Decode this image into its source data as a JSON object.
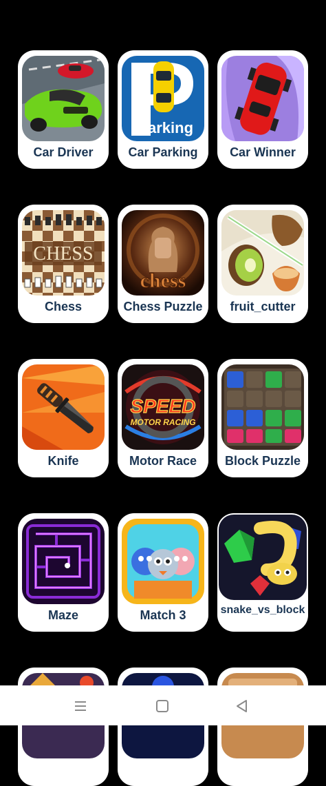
{
  "apps": [
    {
      "name": "Car Driver",
      "icon": "car-driver-icon"
    },
    {
      "name": "Car Parking",
      "icon": "car-parking-icon",
      "icon_text": "arking"
    },
    {
      "name": "Car Winner",
      "icon": "car-winner-icon"
    },
    {
      "name": "Chess",
      "icon": "chess-icon",
      "icon_text": "CHESS"
    },
    {
      "name": "Chess Puzzle",
      "icon": "chess-puzzle-icon",
      "icon_text": "chess"
    },
    {
      "name": "fruit_cutter",
      "icon": "fruit-cutter-icon"
    },
    {
      "name": "Knife",
      "icon": "knife-icon"
    },
    {
      "name": "Motor Race",
      "icon": "motor-race-icon",
      "icon_text_1": "SPEED",
      "icon_text_2": "MOTOR RACING"
    },
    {
      "name": "Block Puzzle",
      "icon": "block-puzzle-icon"
    },
    {
      "name": "Maze",
      "icon": "maze-icon"
    },
    {
      "name": "Match 3",
      "icon": "match-3-icon"
    },
    {
      "name": "snake_vs_block",
      "icon": "snake-vs-block-icon"
    }
  ],
  "navbar": {
    "recents": "menu-icon",
    "home": "square-icon",
    "back": "triangle-back-icon"
  },
  "colors": {
    "background": "#000000",
    "card": "#ffffff",
    "label": "#1a3553",
    "navbar": "#ffffff"
  }
}
